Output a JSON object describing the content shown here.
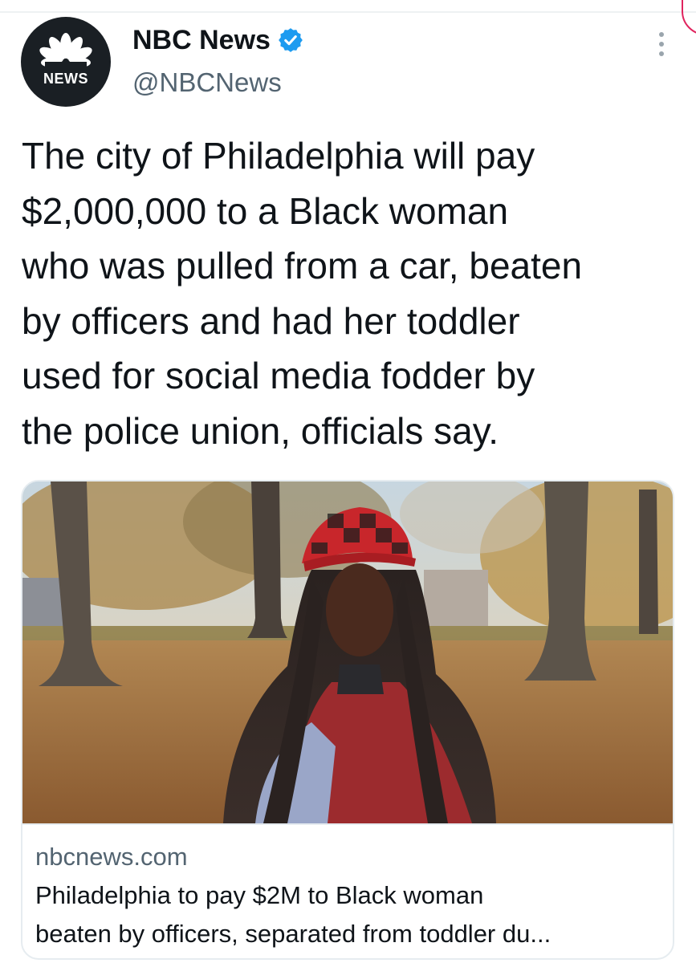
{
  "account": {
    "display_name": "NBC News",
    "handle": "@NBCNews",
    "avatar_label": "NEWS",
    "verified": true,
    "avatar_icon": "nbc-peacock-icon",
    "verified_icon": "verified-badge-icon"
  },
  "tweet": {
    "text_lines": [
      "The city of Philadelphia will pay",
      "$2,000,000 to a Black woman",
      "who was pulled from a car, beaten",
      "by officers and had her toddler",
      "used for social media fodder by",
      "the police union, officials say."
    ]
  },
  "link_card": {
    "domain": "nbcnews.com",
    "title_lines": [
      "Philadelphia to pay $2M to Black woman",
      "beaten by officers, separated from toddler du..."
    ]
  },
  "menu": {
    "icon": "more-options-icon"
  },
  "colors": {
    "text": "#0f1419",
    "secondary": "#536471",
    "verified": "#1d9bf0",
    "border": "#e6ecf0",
    "avatar_bg": "#1a1f24",
    "hat_red": "#c8262b"
  }
}
